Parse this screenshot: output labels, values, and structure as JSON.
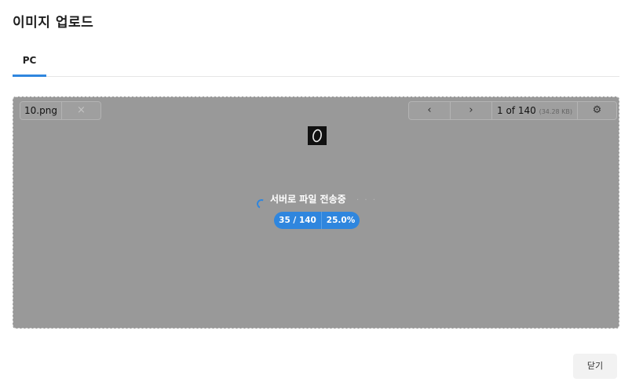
{
  "dialog": {
    "title": "이미지 업로드"
  },
  "tabs": [
    {
      "label": "PC",
      "active": true
    }
  ],
  "file": {
    "name": "10.png",
    "close_icon": "×"
  },
  "pager": {
    "prev_icon": "‹",
    "next_icon": "›",
    "current": "1",
    "of_label": "of",
    "total": "140",
    "size": "(34.28 KB)",
    "settings_icon": "⚙"
  },
  "upload": {
    "status_text": "서버로 파일 전송중",
    "dots": ". . .",
    "count": "35 / 140",
    "percent": "25.0%",
    "progress": 0.25
  },
  "footer": {
    "close_label": "닫기"
  },
  "colors": {
    "accent": "#2f86de",
    "overlay": "#999999"
  }
}
